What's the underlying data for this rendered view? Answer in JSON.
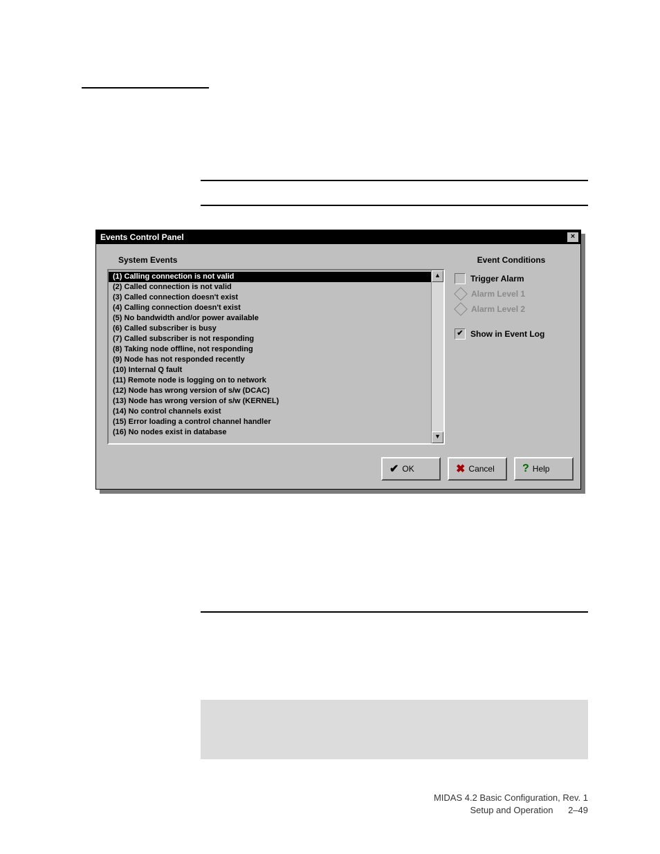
{
  "dialog": {
    "title": "Events Control Panel",
    "close_glyph": "×",
    "system_events_heading": "System Events",
    "events": [
      "(1) Calling connection is not valid",
      "(2) Called connection is not valid",
      "(3) Called connection doesn't exist",
      "(4) Calling connection doesn't exist",
      "(5) No bandwidth and/or power available",
      "(6) Called subscriber is busy",
      "(7) Called subscriber is not responding",
      "(8) Taking node offline, not responding",
      "(9) Node has not responded recently",
      "(10) Internal Q fault",
      "(11) Remote node is logging on to network",
      "(12) Node has wrong version of s/w (DCAC)",
      "(13) Node has wrong version of s/w (KERNEL)",
      "(14) No control channels exist",
      "(15) Error loading a control channel handler",
      "(16) No nodes exist in database"
    ],
    "selected_index": 0,
    "conditions": {
      "heading": "Event Conditions",
      "trigger_alarm": {
        "label": "Trigger Alarm",
        "checked": false
      },
      "alarm_level_1": {
        "label": "Alarm Level 1"
      },
      "alarm_level_2": {
        "label": "Alarm Level 2"
      },
      "show_in_log": {
        "label": "Show in Event Log",
        "checked": true
      }
    },
    "buttons": {
      "ok": {
        "label": "OK",
        "glyph": "✔"
      },
      "cancel": {
        "label": "Cancel",
        "glyph": "✖"
      },
      "help": {
        "label": "Help",
        "glyph": "?"
      }
    },
    "scroll": {
      "up_glyph": "▲",
      "down_glyph": "▼"
    }
  },
  "footer": {
    "line1": "MIDAS 4.2 Basic Configuration, Rev. 1",
    "line2_text": "Setup and Operation",
    "page": "2–49"
  }
}
